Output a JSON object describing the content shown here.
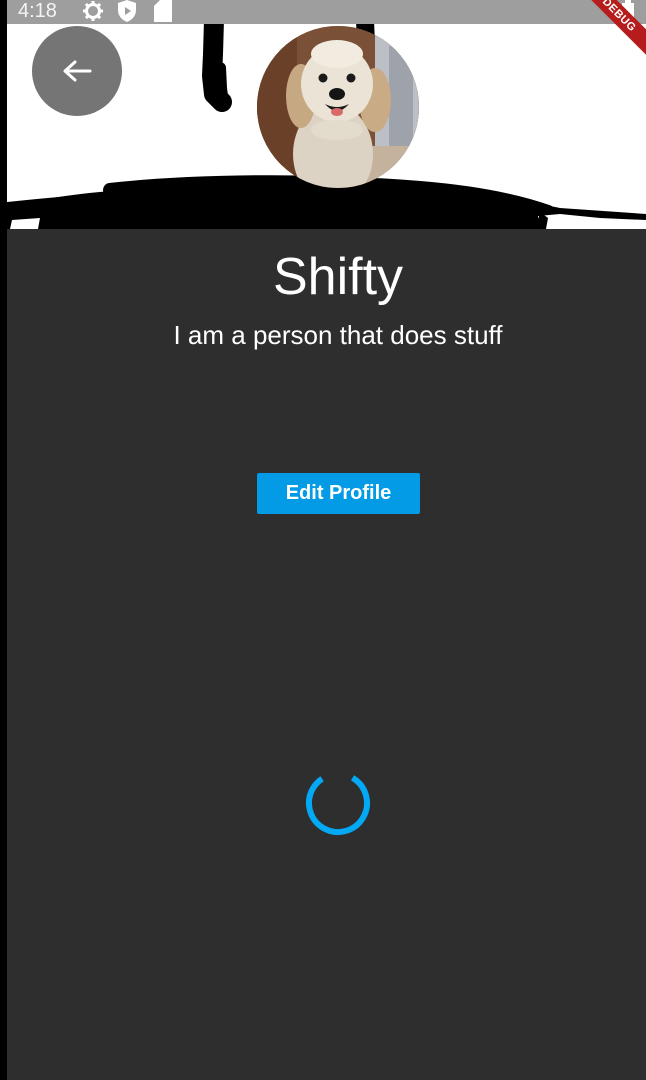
{
  "status_bar": {
    "time": "4:18",
    "icons": [
      "gear-icon",
      "play-protect-icon",
      "sd-card-icon",
      "battery-icon"
    ],
    "background": "#9e9e9e"
  },
  "debug_banner": {
    "label": "DEBUG",
    "color": "#b71c1c"
  },
  "header": {
    "back_icon": "arrow-back-icon",
    "back_button_color": "#757575",
    "avatar_icon": "dog-avatar-icon",
    "banner_background": "#ffffff",
    "banner_scribble_color": "#000000"
  },
  "profile": {
    "name": "Shifty",
    "bio": "I am a person that does stuff"
  },
  "actions": {
    "edit_profile_label": "Edit Profile",
    "accent": "#039be5"
  },
  "loading": {
    "indicator_icon": "loading-spinner-icon",
    "color": "#03a9f4"
  },
  "theme": {
    "content_background": "#2e2e2e",
    "text_color": "#ffffff"
  }
}
